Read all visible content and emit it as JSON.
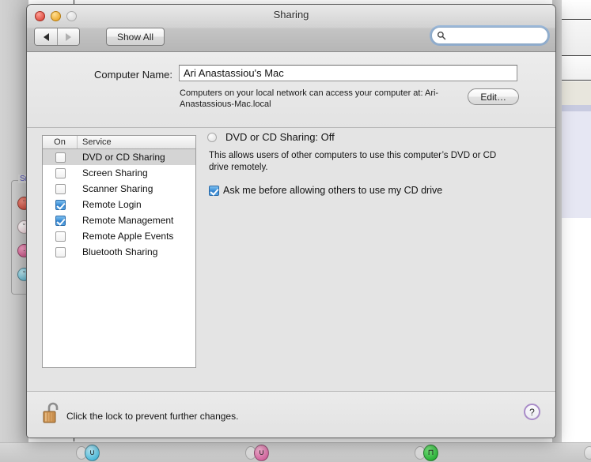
{
  "window": {
    "title": "Sharing",
    "traffic_lights": [
      "close",
      "minimize",
      "zoom"
    ]
  },
  "toolbar": {
    "back_label": "◀",
    "forward_label": "▶",
    "show_all_label": "Show All",
    "search_value": "",
    "search_placeholder": ""
  },
  "computer_name": {
    "label": "Computer Name:",
    "value": "Ari Anastassiou's Mac",
    "hint": "Computers on your local network can access your computer at: Ari-Anastassious-Mac.local",
    "edit_label": "Edit…"
  },
  "service_list": {
    "headers": {
      "on": "On",
      "service": "Service"
    },
    "rows": [
      {
        "label": "DVD or CD Sharing",
        "checked": false,
        "selected": true
      },
      {
        "label": "Screen Sharing",
        "checked": false,
        "selected": false
      },
      {
        "label": "Scanner Sharing",
        "checked": false,
        "selected": false
      },
      {
        "label": "Remote Login",
        "checked": true,
        "selected": false
      },
      {
        "label": "Remote Management",
        "checked": true,
        "selected": false
      },
      {
        "label": "Remote Apple Events",
        "checked": false,
        "selected": false
      },
      {
        "label": "Bluetooth Sharing",
        "checked": false,
        "selected": false
      }
    ]
  },
  "detail": {
    "status_text": "DVD or CD Sharing: Off",
    "description": "This allows users of other computers to use this computer’s DVD or CD drive remotely.",
    "ask_checkbox_label": "Ask me before allowing others to use my CD drive",
    "ask_checkbox_checked": true
  },
  "footer": {
    "lock_text": "Click the lock to prevent further changes.",
    "help_label": "?"
  },
  "background": {
    "smiley_legend": "Sm",
    "palette_faces": [
      "¨",
      "˘",
      "·",
      "˜"
    ],
    "dock_faces": [
      "∪",
      "∪",
      "⊓"
    ]
  },
  "colors": {
    "accent_blue": "#3b8fd8",
    "window_bg": "#e4e4e4",
    "help_purple": "#a98cc8",
    "selected_row": "#d4d4d4"
  }
}
